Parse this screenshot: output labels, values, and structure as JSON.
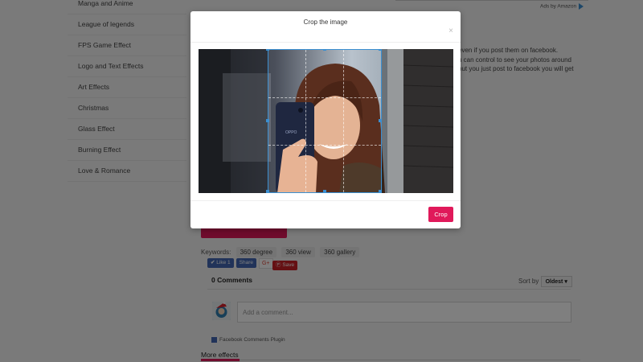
{
  "sidebar": {
    "items": [
      {
        "label": "Manga and Anime"
      },
      {
        "label": "League of legends"
      },
      {
        "label": "FPS Game Effect"
      },
      {
        "label": "Logo and Text Effects"
      },
      {
        "label": "Art Effects"
      },
      {
        "label": "Christmas"
      },
      {
        "label": "Glass Effect"
      },
      {
        "label": "Burning Effect"
      },
      {
        "label": "Love & Romance"
      }
    ]
  },
  "ads": {
    "label": "Ads by Amazon"
  },
  "article": {
    "lines": [
      "even if you post them on facebook.",
      "u can control to see your photos around",
      "but you just post to facebook you will get"
    ]
  },
  "keywords": {
    "label": "Keywords:",
    "items": [
      "360 degree",
      "360 view",
      "360 gallery"
    ]
  },
  "share": {
    "like": "Like 1",
    "share": "Share",
    "gplus": "G+",
    "save": "Save"
  },
  "comments": {
    "count_label": "0 Comments",
    "sort_label": "Sort by",
    "sort_value": "Oldest",
    "placeholder": "Add a comment...",
    "plugin_label": "Facebook Comments Plugin"
  },
  "more_effects": {
    "label": "More effects"
  },
  "modal": {
    "title": "Crop the image",
    "close": "×",
    "crop_label": "Crop"
  },
  "phone_brand": "OPPO",
  "colors": {
    "accent": "#e0195a",
    "facebook": "#4267b2",
    "crop_guide": "#3b8fd1"
  }
}
